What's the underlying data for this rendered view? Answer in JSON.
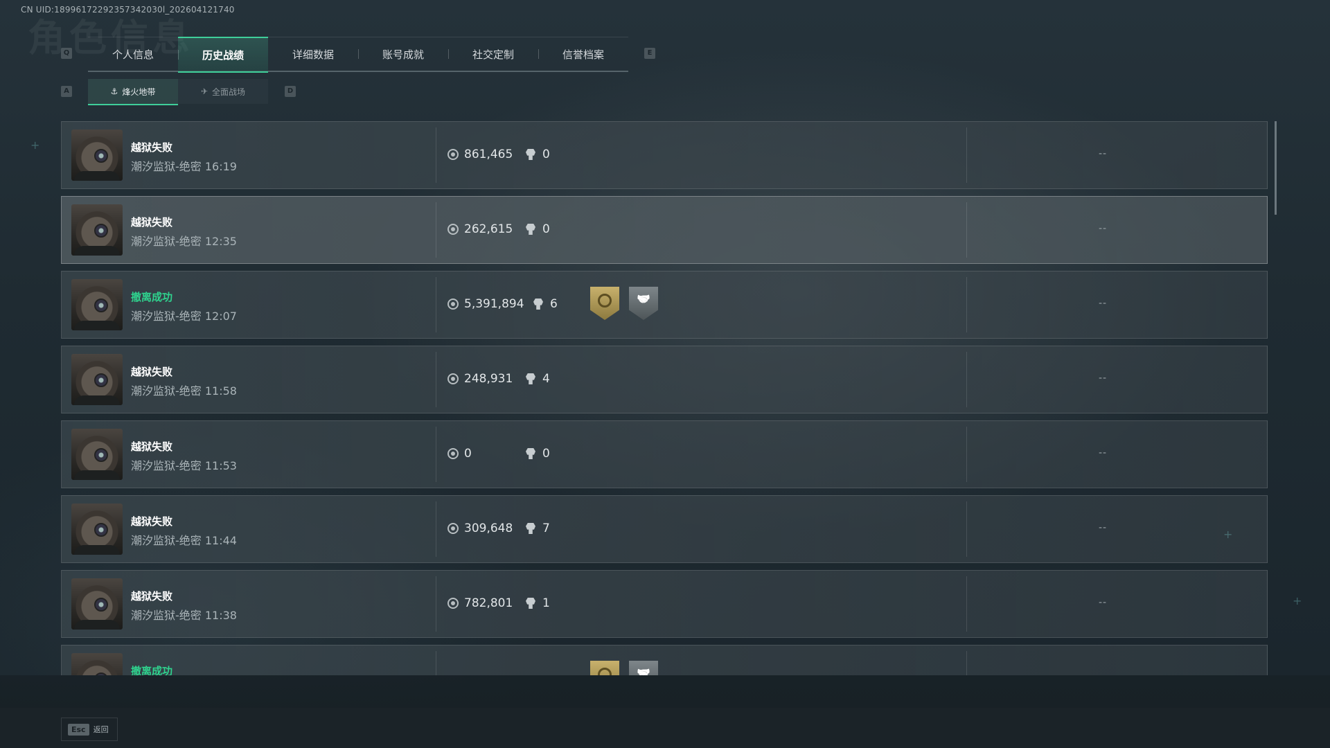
{
  "uid": "CN UID:18996172292357342030l_202604121740",
  "keys": {
    "prev_tab": "Q",
    "next_tab": "E",
    "prev_sub": "A",
    "next_sub": "D"
  },
  "tabs": [
    {
      "label": "个人信息",
      "active": false
    },
    {
      "label": "历史战绩",
      "active": true
    },
    {
      "label": "详细数据",
      "active": false
    },
    {
      "label": "账号成就",
      "active": false
    },
    {
      "label": "社交定制",
      "active": false
    },
    {
      "label": "信誉档案",
      "active": false
    }
  ],
  "subtabs": [
    {
      "label": "烽火地带",
      "icon": "⚓",
      "active": true
    },
    {
      "label": "全面战场",
      "icon": "✈",
      "active": false
    }
  ],
  "matches": [
    {
      "result": "越狱失败",
      "success": false,
      "map": "潮汐监狱-绝密 16:19",
      "value": "861,465",
      "kills": "0",
      "badges": [],
      "extra": "--"
    },
    {
      "result": "越狱失败",
      "success": false,
      "map": "潮汐监狱-绝密 12:35",
      "value": "262,615",
      "kills": "0",
      "badges": [],
      "extra": "--"
    },
    {
      "result": "撤离成功",
      "success": true,
      "map": "潮汐监狱-绝密 12:07",
      "value": "5,391,894",
      "kills": "6",
      "badges": [
        "gold-target-badge",
        "grey-handshake-badge"
      ],
      "extra": "--"
    },
    {
      "result": "越狱失败",
      "success": false,
      "map": "潮汐监狱-绝密 11:58",
      "value": "248,931",
      "kills": "4",
      "badges": [],
      "extra": "--"
    },
    {
      "result": "越狱失败",
      "success": false,
      "map": "潮汐监狱-绝密 11:53",
      "value": "0",
      "kills": "0",
      "badges": [],
      "extra": "--"
    },
    {
      "result": "越狱失败",
      "success": false,
      "map": "潮汐监狱-绝密 11:44",
      "value": "309,648",
      "kills": "7",
      "badges": [],
      "extra": "--"
    },
    {
      "result": "越狱失败",
      "success": false,
      "map": "潮汐监狱-绝密 11:38",
      "value": "782,801",
      "kills": "1",
      "badges": [],
      "extra": "--"
    },
    {
      "result": "撤离成功",
      "success": true,
      "map": "",
      "value": "",
      "kills": "",
      "badges": [
        "gold-target-badge",
        "grey-handshake-badge"
      ],
      "extra": ""
    }
  ],
  "footer": {
    "esc_key": "Esc",
    "back_label": "返回"
  },
  "colors": {
    "accent": "#3fcf9a",
    "success": "#2fd38e"
  }
}
